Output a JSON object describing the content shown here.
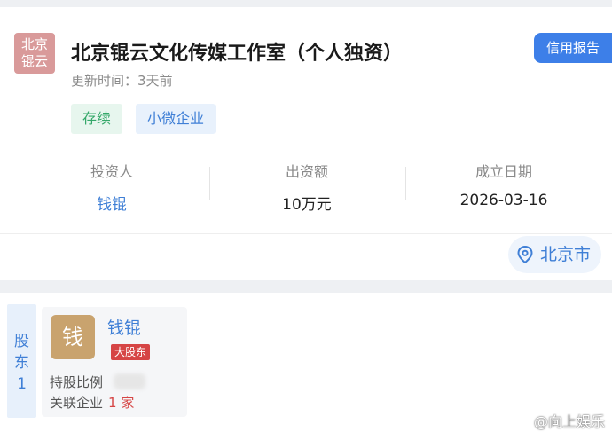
{
  "company": {
    "logo_lines": [
      "北京",
      "锟云"
    ],
    "name": "北京锟云文化传媒工作室（个人独资）",
    "credit_report_label": "信用报告",
    "update_time": "更新时间：3天前",
    "tags": [
      "存续",
      "小微企业"
    ]
  },
  "info": {
    "investor_label": "投资人",
    "investor_value": "钱锟",
    "capital_label": "出资额",
    "capital_value": "10万元",
    "founded_label": "成立日期",
    "founded_value": "2026-03-16"
  },
  "location": {
    "label": "北京市",
    "icon": "location-pin-icon"
  },
  "shareholders": {
    "strip_chars": [
      "股",
      "东",
      "1"
    ],
    "avatar_char": "钱",
    "name": "钱锟",
    "badge": "大股东",
    "ratio_label": "持股比例",
    "related_label": "关联企业",
    "related_count": "1 家"
  },
  "watermark": "@向上娱乐",
  "colors": {
    "accent": "#3d7fe8",
    "green": "#35a86a",
    "red": "#d64545",
    "logo_bg": "#d99a9a",
    "avatar_bg": "#c9a36e"
  }
}
